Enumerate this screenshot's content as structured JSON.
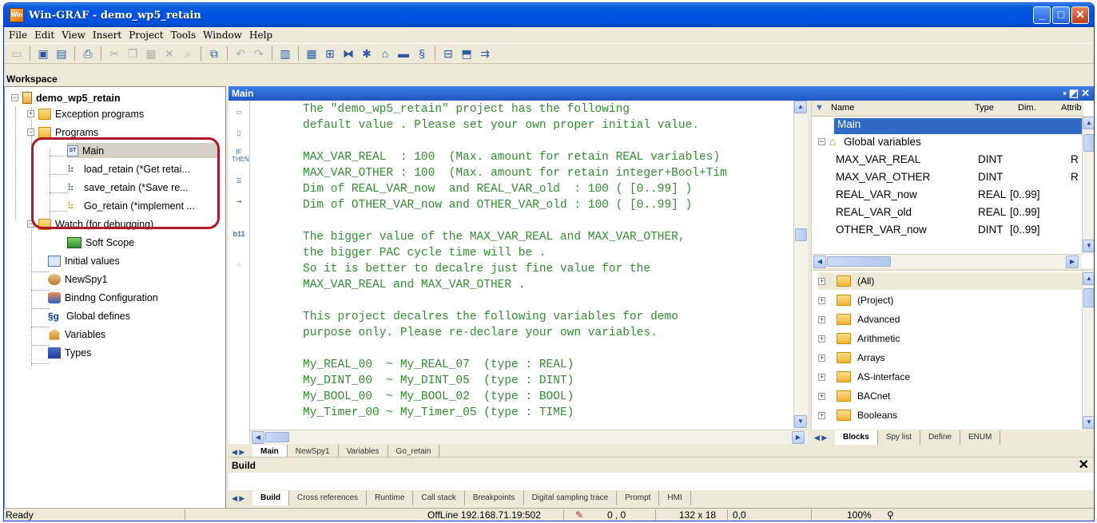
{
  "window": {
    "title": "Win-GRAF  - demo_wp5_retain",
    "app_icon_text": "Win",
    "minimize": "_",
    "maximize": "□",
    "close": "✕"
  },
  "menu": [
    "File",
    "Edit",
    "View",
    "Insert",
    "Project",
    "Tools",
    "Window",
    "Help"
  ],
  "workspace": {
    "title": "Workspace",
    "root": "demo_wp5_retain",
    "nodes": {
      "exception": "Exception programs",
      "programs": "Programs",
      "main": "Main",
      "load": "load_retain (*Get retai...",
      "save": "save_retain (*Save re...",
      "go": "Go_retain (*implement ...",
      "watch": "Watch (for debugging)",
      "scope": "Soft Scope",
      "initial": "Initial values",
      "spy": "NewSpy1",
      "binding": "Bindng Configuration",
      "globaldef": "Global defines",
      "variables": "Variables",
      "types": "Types"
    },
    "prog_badge": "ST"
  },
  "editor": {
    "title": "Main",
    "lines": [
      "The \"demo_wp5_retain\" project has the following",
      "default value . Please set your own proper initial value.",
      "",
      "MAX_VAR_REAL  : 100  (Max. amount for retain REAL variables)",
      "MAX_VAR_OTHER : 100  (Max. amount for retain integer+Bool+Tim",
      "Dim of REAL_VAR_now  and REAL_VAR_old  : 100 ( [0..99] )",
      "Dim of OTHER_VAR_now and OTHER_VAR_old : 100 ( [0..99] )",
      "",
      "The bigger value of the MAX_VAR_REAL and MAX_VAR_OTHER,",
      "the bigger PAC cycle time will be .",
      "So it is better to decalre just fine value for the",
      "MAX_VAR_REAL and MAX_VAR_OTHER .",
      "",
      "This project decalres the following variables for demo",
      "purpose only. Please re-declare your own variables.",
      "",
      "My_REAL_00  ~ My_REAL_07  (type : REAL)",
      "My_DINT_00  ~ My_DINT_05  (type : DINT)",
      "My_BOOL_00  ~ My_BOOL_02  (type : BOOL)",
      "My_Timer_00 ~ My_Timer_05 (type : TIME)"
    ],
    "tabs": [
      "Main",
      "NewSpy1",
      "Variables",
      "Go_retain"
    ]
  },
  "variables": {
    "columns": [
      "Name",
      "Type",
      "Dim.",
      "Attrib"
    ],
    "main_row": "Main",
    "group": "Global variables",
    "rows": [
      {
        "name": "MAX_VAR_REAL",
        "type": "DINT",
        "dim": "",
        "attr": "R"
      },
      {
        "name": "MAX_VAR_OTHER",
        "type": "DINT",
        "dim": "",
        "attr": "R"
      },
      {
        "name": "REAL_VAR_now",
        "type": "REAL",
        "dim": "[0..99]",
        "attr": ""
      },
      {
        "name": "REAL_VAR_old",
        "type": "REAL",
        "dim": "[0..99]",
        "attr": ""
      },
      {
        "name": "OTHER_VAR_now",
        "type": "DINT",
        "dim": "[0..99]",
        "attr": ""
      }
    ]
  },
  "blocks": {
    "items": [
      "(All)",
      "(Project)",
      "Advanced",
      "Arithmetic",
      "Arrays",
      "AS-interface",
      "BACnet",
      "Booleans"
    ],
    "tabs": [
      "Blocks",
      "Spy list",
      "Define",
      "ENUM"
    ]
  },
  "build": {
    "title": "Build",
    "close": "✕",
    "tabs": [
      "Build",
      "Cross references",
      "Runtime",
      "Call stack",
      "Breakpoints",
      "Digital sampling trace",
      "Prompt",
      "HMI"
    ]
  },
  "status": {
    "ready": "Ready",
    "connection": "OffLine 192.168.71.19:502",
    "pos": "0 , 0",
    "size": "132 x 18",
    "coord": "0,0",
    "zoom": "100%"
  }
}
